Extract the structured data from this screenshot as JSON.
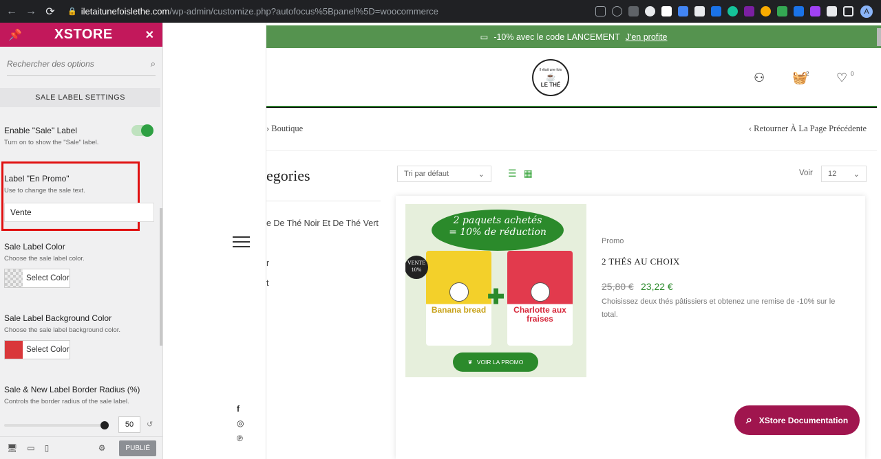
{
  "browser": {
    "url_host": "iletaitunefoislethe.com",
    "url_path": "/wp-admin/customize.php?autofocus%5Bpanel%5D=woocommerce",
    "avatar_initial": "A"
  },
  "sidebar": {
    "brand": "XSTORE",
    "search_placeholder": "Rechercher des options",
    "section_title": "SALE LABEL SETTINGS",
    "enable_label": "Enable \"Sale\" Label",
    "enable_desc": "Turn on to show the \"Sale\" label.",
    "enable_on": true,
    "en_promo_label": "Label \"En Promo\"",
    "en_promo_desc": "Use to change the sale text.",
    "en_promo_value": "Vente",
    "color_label": "Sale Label Color",
    "color_desc": "Choose the sale label color.",
    "select_color": "Select Color",
    "bg_label": "Sale Label Background Color",
    "bg_desc": "Choose the sale label background color.",
    "bg_color": "#d9373a",
    "radius_label": "Sale & New Label Border Radius (%)",
    "radius_desc": "Controls the border radius of the sale label.",
    "radius_value": "50",
    "publish_label": "PUBLIÉ"
  },
  "preview": {
    "banner_text": "-10% avec le code LANCEMENT",
    "banner_link": "J'en profite",
    "logo_text_top": "Il était une fois",
    "logo_text_bottom": "LE THÉ",
    "cart_count": "2",
    "wishlist_count": "0",
    "breadcrumb": "› Boutique",
    "back_link": "‹ Retourner À La Page Précédente",
    "categories_title": "egories",
    "cat_items": [
      "e De Thé Noir Et De Thé Vert",
      "r",
      "t"
    ],
    "sort_default": "Tri par défaut",
    "voir_label": "Voir",
    "per_page": "12",
    "product": {
      "promo_line1": "2 paquets achetés",
      "promo_line2": "= 10% de réduction",
      "bag1_name": "Banana bread",
      "bag2_name": "Charlotte aux fraises",
      "sale_badge": "VENTE 10%",
      "promo_button": "VOIR LA PROMO",
      "category": "Promo",
      "title": "2 THÉS AU CHOIX",
      "old_price": "25,80 €",
      "new_price": "23,22 €",
      "description": "Choisissez deux thés pâtissiers et obtenez une remise de -10% sur le total."
    },
    "doc_button": "XStore Documentation"
  }
}
